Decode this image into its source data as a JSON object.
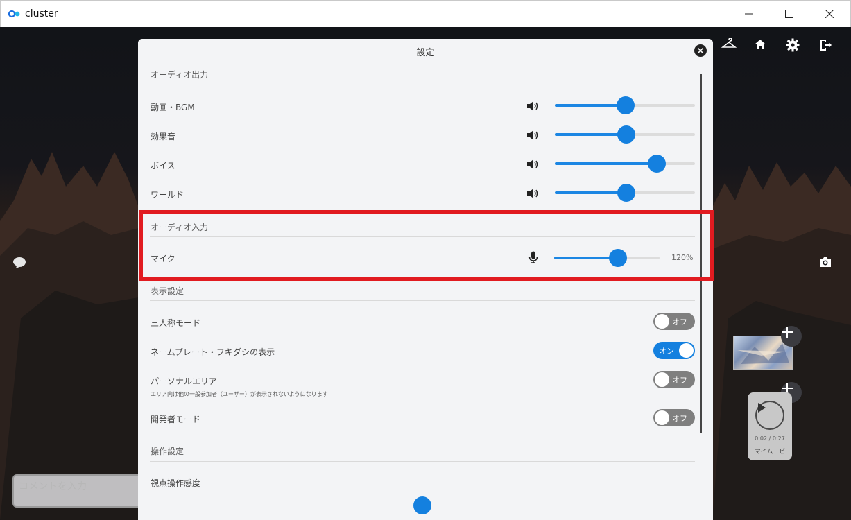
{
  "window": {
    "title": "cluster",
    "controls": [
      "minimize",
      "maximize",
      "close"
    ]
  },
  "hud": {
    "top_icons": [
      "hanger-icon",
      "home-icon",
      "gear-icon",
      "exit-icon"
    ],
    "comment_placeholder": "コメントを入力"
  },
  "settings": {
    "title": "設定",
    "audio_output": {
      "heading": "オーディオ出力",
      "rows": [
        {
          "label": "動画・BGM",
          "value": 0.51
        },
        {
          "label": "効果音",
          "value": 0.51
        },
        {
          "label": "ボイス",
          "value": 0.73
        },
        {
          "label": "ワールド",
          "value": 0.51
        }
      ]
    },
    "audio_input": {
      "heading": "オーディオ入力",
      "mic_label": "マイク",
      "mic_value": 0.59,
      "mic_percent": "120%"
    },
    "display": {
      "heading": "表示設定",
      "third_person": {
        "label": "三人称モード",
        "state": "オフ"
      },
      "nameplate": {
        "label": "ネームプレート・フキダシの表示",
        "state": "オン"
      },
      "personal_area": {
        "label": "パーソナルエリア",
        "sub": "エリア内は他の一般参加者（ユーザー）が表示されないようになります",
        "state": "オフ"
      },
      "developer": {
        "label": "開発者モード",
        "state": "オフ"
      }
    },
    "controls": {
      "heading": "操作設定",
      "sensitivity_label": "視点操作感度"
    }
  },
  "media": {
    "time": "0:02 / 0:27",
    "name": "マイムービ"
  },
  "colors": {
    "accent": "#1480df",
    "highlight": "#e11b20",
    "toggle_off": "#7f7f7f"
  }
}
